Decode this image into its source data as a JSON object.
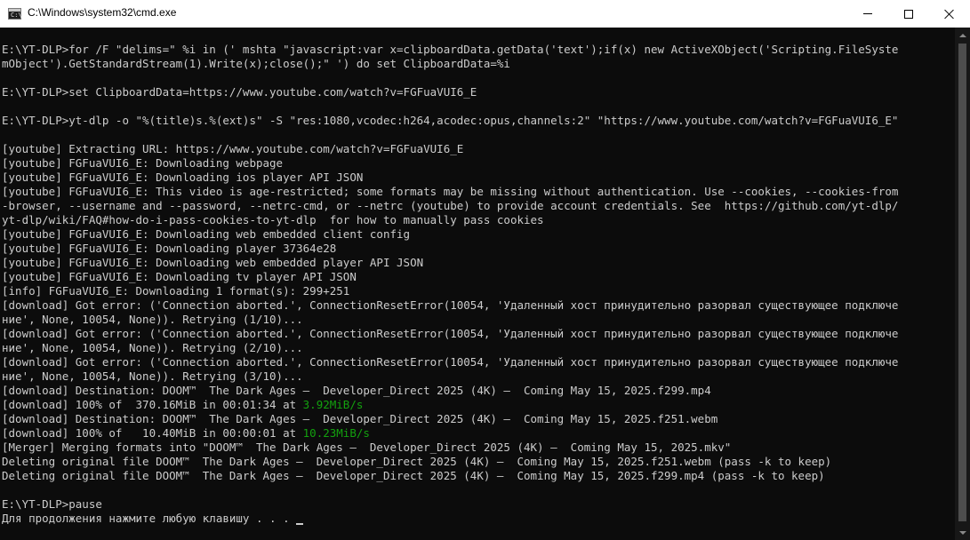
{
  "window": {
    "title": "C:\\Windows\\system32\\cmd.exe",
    "icon": "cmd-console-icon",
    "icon_prompt": "C:\\",
    "controls": [
      "minimize-icon",
      "maximize-icon",
      "close-icon"
    ]
  },
  "colors": {
    "background": "#0c0c0c",
    "text": "#cccccc",
    "speed_green": "#13a10e",
    "titlebar": "#ffffff"
  },
  "console": {
    "lines": [
      {
        "text": ""
      },
      {
        "text": "E:\\YT-DLP>for /F \"delims=\" %i in (' mshta \"javascript:var x=clipboardData.getData('text');if(x) new ActiveXObject('Scripting.FileSyste"
      },
      {
        "text": "mObject').GetStandardStream(1).Write(x);close();\" ') do set ClipboardData=%i"
      },
      {
        "text": ""
      },
      {
        "text": "E:\\YT-DLP>set ClipboardData=https://www.youtube.com/watch?v=FGFuaVUI6_E"
      },
      {
        "text": ""
      },
      {
        "text": "E:\\YT-DLP>yt-dlp -o \"%(title)s.%(ext)s\" -S \"res:1080,vcodec:h264,acodec:opus,channels:2\" \"https://www.youtube.com/watch?v=FGFuaVUI6_E\""
      },
      {
        "text": ""
      },
      {
        "text": "[youtube] Extracting URL: https://www.youtube.com/watch?v=FGFuaVUI6_E"
      },
      {
        "text": "[youtube] FGFuaVUI6_E: Downloading webpage"
      },
      {
        "text": "[youtube] FGFuaVUI6_E: Downloading ios player API JSON"
      },
      {
        "text": "[youtube] FGFuaVUI6_E: This video is age-restricted; some formats may be missing without authentication. Use --cookies, --cookies-from"
      },
      {
        "text": "-browser, --username and --password, --netrc-cmd, or --netrc (youtube) to provide account credentials. See  https://github.com/yt-dlp/"
      },
      {
        "text": "yt-dlp/wiki/FAQ#how-do-i-pass-cookies-to-yt-dlp  for how to manually pass cookies"
      },
      {
        "text": "[youtube] FGFuaVUI6_E: Downloading web embedded client config"
      },
      {
        "text": "[youtube] FGFuaVUI6_E: Downloading player 37364e28"
      },
      {
        "text": "[youtube] FGFuaVUI6_E: Downloading web embedded player API JSON"
      },
      {
        "text": "[youtube] FGFuaVUI6_E: Downloading tv player API JSON"
      },
      {
        "text": "[info] FGFuaVUI6_E: Downloading 1 format(s): 299+251"
      },
      {
        "text": "[download] Got error: ('Connection aborted.', ConnectionResetError(10054, 'Удаленный хост принудительно разорвал существующее подключе"
      },
      {
        "text": "ние', None, 10054, None)). Retrying (1/10)..."
      },
      {
        "text": "[download] Got error: ('Connection aborted.', ConnectionResetError(10054, 'Удаленный хост принудительно разорвал существующее подключе"
      },
      {
        "text": "ние', None, 10054, None)). Retrying (2/10)..."
      },
      {
        "text": "[download] Got error: ('Connection aborted.', ConnectionResetError(10054, 'Удаленный хост принудительно разорвал существующее подключе"
      },
      {
        "text": "ние', None, 10054, None)). Retrying (3/10)..."
      },
      {
        "text": "[download] Destination: DOOM™  The Dark Ages –  Developer_Direct 2025 (4K) –  Coming May 15, 2025.f299.mp4"
      },
      {
        "text": "[download] 100% of  370.16MiB in 00:01:34 at ",
        "speed": "3.92MiB/s"
      },
      {
        "text": "[download] Destination: DOOM™  The Dark Ages –  Developer_Direct 2025 (4K) –  Coming May 15, 2025.f251.webm"
      },
      {
        "text": "[download] 100% of   10.40MiB in 00:00:01 at ",
        "speed": "10.23MiB/s"
      },
      {
        "text": "[Merger] Merging formats into \"DOOM™  The Dark Ages –  Developer_Direct 2025 (4K) –  Coming May 15, 2025.mkv\""
      },
      {
        "text": "Deleting original file DOOM™  The Dark Ages –  Developer_Direct 2025 (4K) –  Coming May 15, 2025.f251.webm (pass -k to keep)"
      },
      {
        "text": "Deleting original file DOOM™  The Dark Ages –  Developer_Direct 2025 (4K) –  Coming May 15, 2025.f299.mp4 (pass -k to keep)"
      },
      {
        "text": ""
      },
      {
        "text": "E:\\YT-DLP>pause"
      },
      {
        "text": "Для продолжения нажмите любую клавишу . . . ",
        "cursor": true
      }
    ]
  },
  "scrollbar": {
    "up_icon": "scroll-up-arrow-icon",
    "down_icon": "scroll-down-arrow-icon"
  }
}
